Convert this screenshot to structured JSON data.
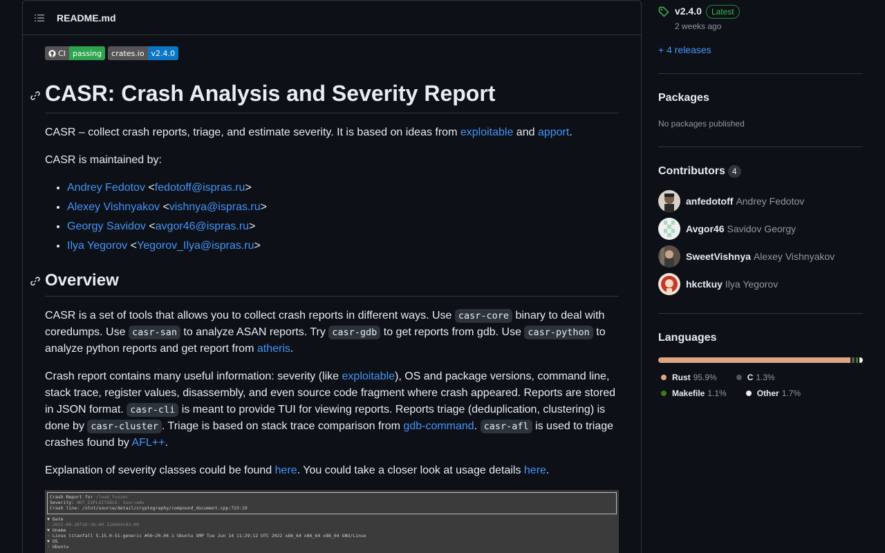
{
  "readme": {
    "filename": "README.md",
    "badges": [
      {
        "left": "CI",
        "right": "passing",
        "color": "#2da44e"
      },
      {
        "left": "crates.io",
        "right": "v2.4.0",
        "color": "#0a76c4"
      }
    ],
    "title": "CASR: Crash Analysis and Severity Report",
    "intro": {
      "before": "CASR – collect crash reports, triage, and estimate severity. It is based on ideas from ",
      "link1": "exploitable",
      "mid": " and ",
      "link2": "apport",
      "after": "."
    },
    "maintained_by": "CASR is maintained by:",
    "maintainers": [
      {
        "name": "Andrey Fedotov",
        "email": "fedotoff@ispras.ru"
      },
      {
        "name": "Alexey Vishnyakov",
        "email": "vishnya@ispras.ru"
      },
      {
        "name": "Georgy Savidov",
        "email": "avgor46@ispras.ru"
      },
      {
        "name": "Ilya Yegorov",
        "email": "Yegorov_Ilya@ispras.ru"
      }
    ],
    "overview_heading": "Overview",
    "p_overview": {
      "t1": "CASR is a set of tools that allows you to collect crash reports in different ways. Use ",
      "c1": "casr-core",
      "t2": " binary to deal with coredumps. Use ",
      "c2": "casr-san",
      "t3": " to analyze ASAN reports. Try ",
      "c3": "casr-gdb",
      "t4": " to get reports from gdb. Use ",
      "c4": "casr-python",
      "t5": " to analyze python reports and get report from ",
      "l1": "atheris",
      "t6": "."
    },
    "p_report": {
      "t1": "Crash report contains many useful information: severity (like ",
      "l1": "exploitable",
      "t2": "), OS and package versions, command line, stack trace, register values, disassembly, and even source code fragment where crash appeared. Reports are stored in JSON format. ",
      "c1": "casr-cli",
      "t3": " is meant to provide TUI for viewing reports. Reports triage (deduplication, clustering) is done by ",
      "c2": "casr-cluster",
      "t4": ". Triage is based on stack trace comparison from ",
      "l2": "gdb-command",
      "t5": ". ",
      "c3": "casr-afl",
      "t6": " is used to triage crashes found by ",
      "l3": "AFL++",
      "t7": "."
    },
    "p_explain": {
      "t1": "Explanation of severity classes could be found ",
      "l1": "here",
      "t2": ". You could take a closer look at usage details ",
      "l2": "here",
      "t3": "."
    },
    "screenshot": {
      "line1a": "Crash Report for ",
      "line1b": "/load_fuzzer",
      "line2a": "Severity: ",
      "line2b": "NOT_EXPLOITABLE: SourceAv",
      "line3": "Crash line: /xlnt/source/detail/cryptography/compound_document.cpp:723:19",
      "line4": "▼ Date",
      "line5": "   ◦ 2022-09-28T16:36:40.129664+03:00",
      "line6": "▼ Uname",
      "line7": "   ◦ Linux titanfall 5.15.0-51-generic #56~20.04.1 Ubuntu SMP Tue Jun 14 11:29:12 UTC 2022 x86_64 x86_64 x86_64 GNU/Linux",
      "line8": "▼ OS",
      "line9": "   ◦ Ubuntu"
    }
  },
  "sidebar": {
    "release": {
      "version": "v2.4.0",
      "badge": "Latest",
      "date": "2 weeks ago",
      "more": "+ 4 releases"
    },
    "packages": {
      "heading": "Packages",
      "empty": "No packages published"
    },
    "contributors": {
      "heading": "Contributors",
      "count": "4",
      "list": [
        {
          "login": "anfedotoff",
          "name": "Andrey Fedotov"
        },
        {
          "login": "Avgor46",
          "name": "Savidov Georgy"
        },
        {
          "login": "SweetVishnya",
          "name": "Alexey Vishnyakov"
        },
        {
          "login": "hkctkuy",
          "name": "Ilya Yegorov"
        }
      ]
    },
    "languages": {
      "heading": "Languages",
      "items": [
        {
          "name": "Rust",
          "percent": "95.9%",
          "value": 95.9,
          "color": "#dea584"
        },
        {
          "name": "C",
          "percent": "1.3%",
          "value": 1.3,
          "color": "#555555"
        },
        {
          "name": "Makefile",
          "percent": "1.1%",
          "value": 1.1,
          "color": "#427819"
        },
        {
          "name": "Other",
          "percent": "1.7%",
          "value": 1.7,
          "color": "#ededed"
        }
      ]
    }
  }
}
